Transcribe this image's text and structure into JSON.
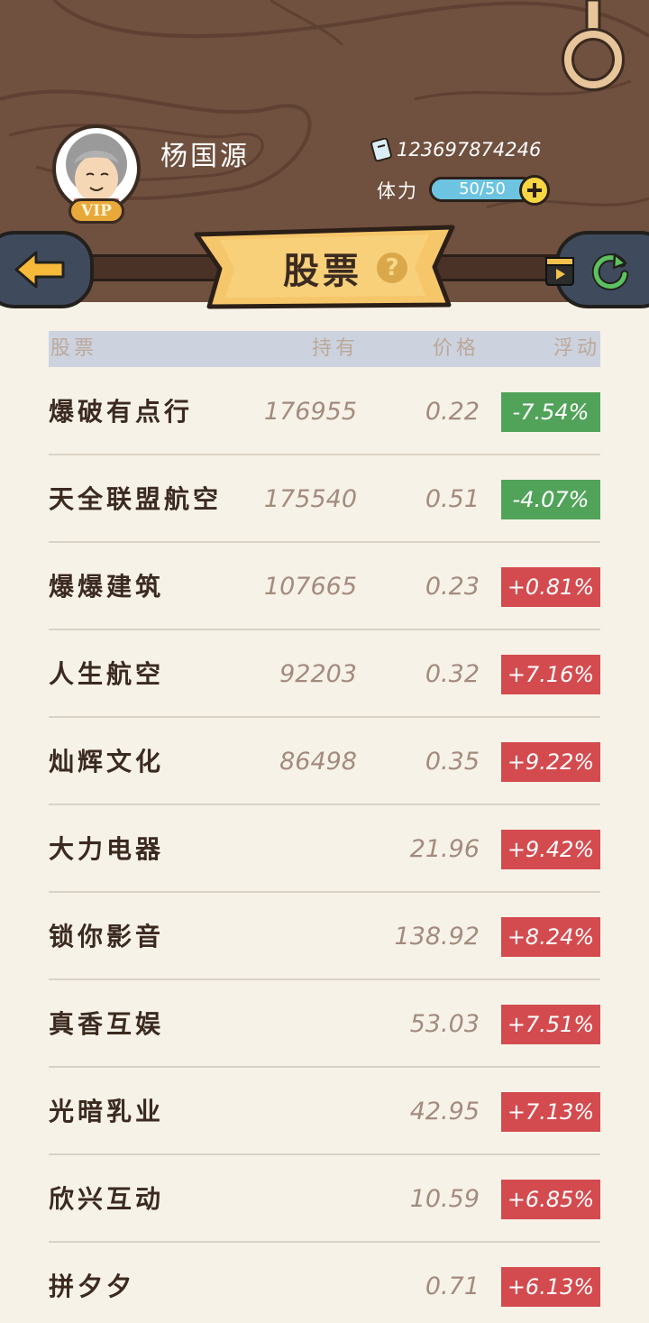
{
  "player": {
    "name": "杨国源",
    "vip": "VIP",
    "id": "123697874246",
    "stamina_label": "体力",
    "stamina_value": "50/50",
    "stamina_fraction": 1.0
  },
  "title": "股票",
  "help": "?",
  "colors": {
    "wood": "#70503f",
    "up": "#d44b4f",
    "down": "#52a35a",
    "banner": "#f6c66a",
    "panel": "#f7f2e8"
  },
  "table": {
    "headers": {
      "name": "股票",
      "hold": "持有",
      "price": "价格",
      "change": "浮动"
    },
    "rows": [
      {
        "name": "爆破有点行",
        "hold": "176955",
        "price": "0.22",
        "change": "-7.54%",
        "direction": "down"
      },
      {
        "name": "天全联盟航空",
        "hold": "175540",
        "price": "0.51",
        "change": "-4.07%",
        "direction": "down"
      },
      {
        "name": "爆爆建筑",
        "hold": "107665",
        "price": "0.23",
        "change": "+0.81%",
        "direction": "up"
      },
      {
        "name": "人生航空",
        "hold": "92203",
        "price": "0.32",
        "change": "+7.16%",
        "direction": "up"
      },
      {
        "name": "灿辉文化",
        "hold": "86498",
        "price": "0.35",
        "change": "+9.22%",
        "direction": "up"
      },
      {
        "name": "大力电器",
        "hold": "",
        "price": "21.96",
        "change": "+9.42%",
        "direction": "up"
      },
      {
        "name": "锁你影音",
        "hold": "",
        "price": "138.92",
        "change": "+8.24%",
        "direction": "up"
      },
      {
        "name": "真香互娱",
        "hold": "",
        "price": "53.03",
        "change": "+7.51%",
        "direction": "up"
      },
      {
        "name": "光暗乳业",
        "hold": "",
        "price": "42.95",
        "change": "+7.13%",
        "direction": "up"
      },
      {
        "name": "欣兴互动",
        "hold": "",
        "price": "10.59",
        "change": "+6.85%",
        "direction": "up"
      },
      {
        "name": "拼夕夕",
        "hold": "",
        "price": "0.71",
        "change": "+6.13%",
        "direction": "up"
      }
    ]
  }
}
